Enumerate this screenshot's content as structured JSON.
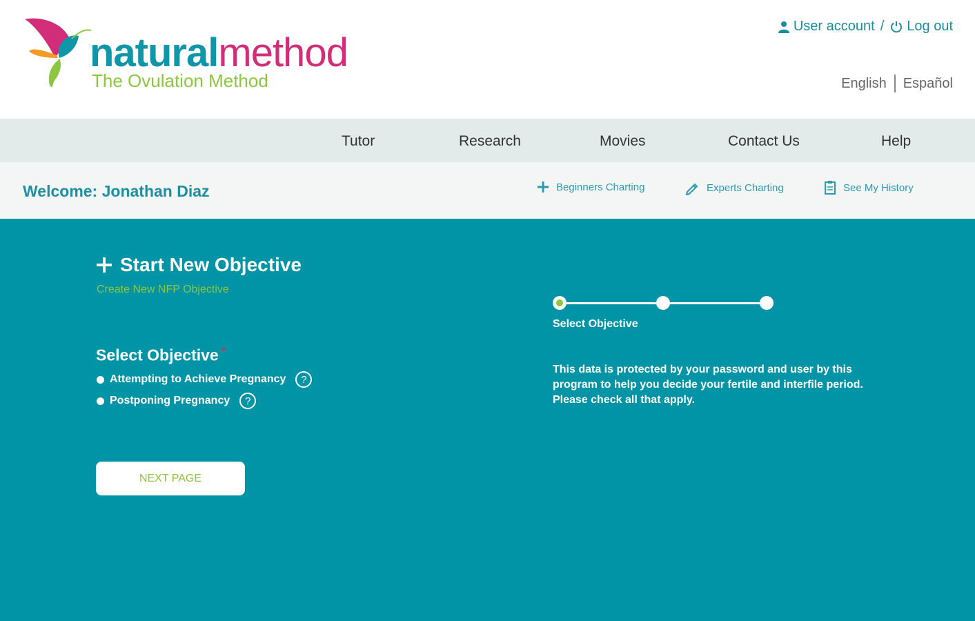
{
  "brand": {
    "word_part1": "natural",
    "word_part2": "method",
    "tagline": "The Ovulation Method",
    "colors": {
      "teal": "#0f96a8",
      "pink": "#d22d78",
      "green": "#8dc63f",
      "orange": "#f59a23"
    }
  },
  "account": {
    "user_account_label": "User account",
    "separator": "/",
    "logout_label": "Log out",
    "user_icon": "user-icon",
    "power_icon": "power-icon"
  },
  "languages": {
    "english": "English",
    "spanish": "Español"
  },
  "nav": {
    "items": [
      {
        "label": "Tutor"
      },
      {
        "label": "Research"
      },
      {
        "label": "Movies"
      },
      {
        "label": "Contact Us"
      },
      {
        "label": "Help"
      }
    ]
  },
  "welcome_bar": {
    "welcome_text": "Welcome: Jonathan Diaz",
    "links": [
      {
        "label": "Beginners Charting",
        "icon": "plus-icon"
      },
      {
        "label": "Experts Charting",
        "icon": "pencil-icon"
      },
      {
        "label": "See My History",
        "icon": "history-icon"
      }
    ]
  },
  "content": {
    "background": "#0094a6",
    "title": "Start New Objective",
    "subtitle": "Create New NFP Objective",
    "field_label": "Select Objective",
    "required_mark": "*",
    "options": [
      {
        "label": "Attempting to Achieve Pregnancy",
        "help": "?"
      },
      {
        "label": "Postponing Pregnancy",
        "help": "?"
      }
    ],
    "next_button": "NEXT PAGE",
    "stepper": {
      "current_step": 1,
      "total_steps": 3,
      "current_label": "Select Objective"
    },
    "info_text": "This data is protected by your password and user by this program to help you decide your fertile and interfile period. Please check all that apply."
  }
}
